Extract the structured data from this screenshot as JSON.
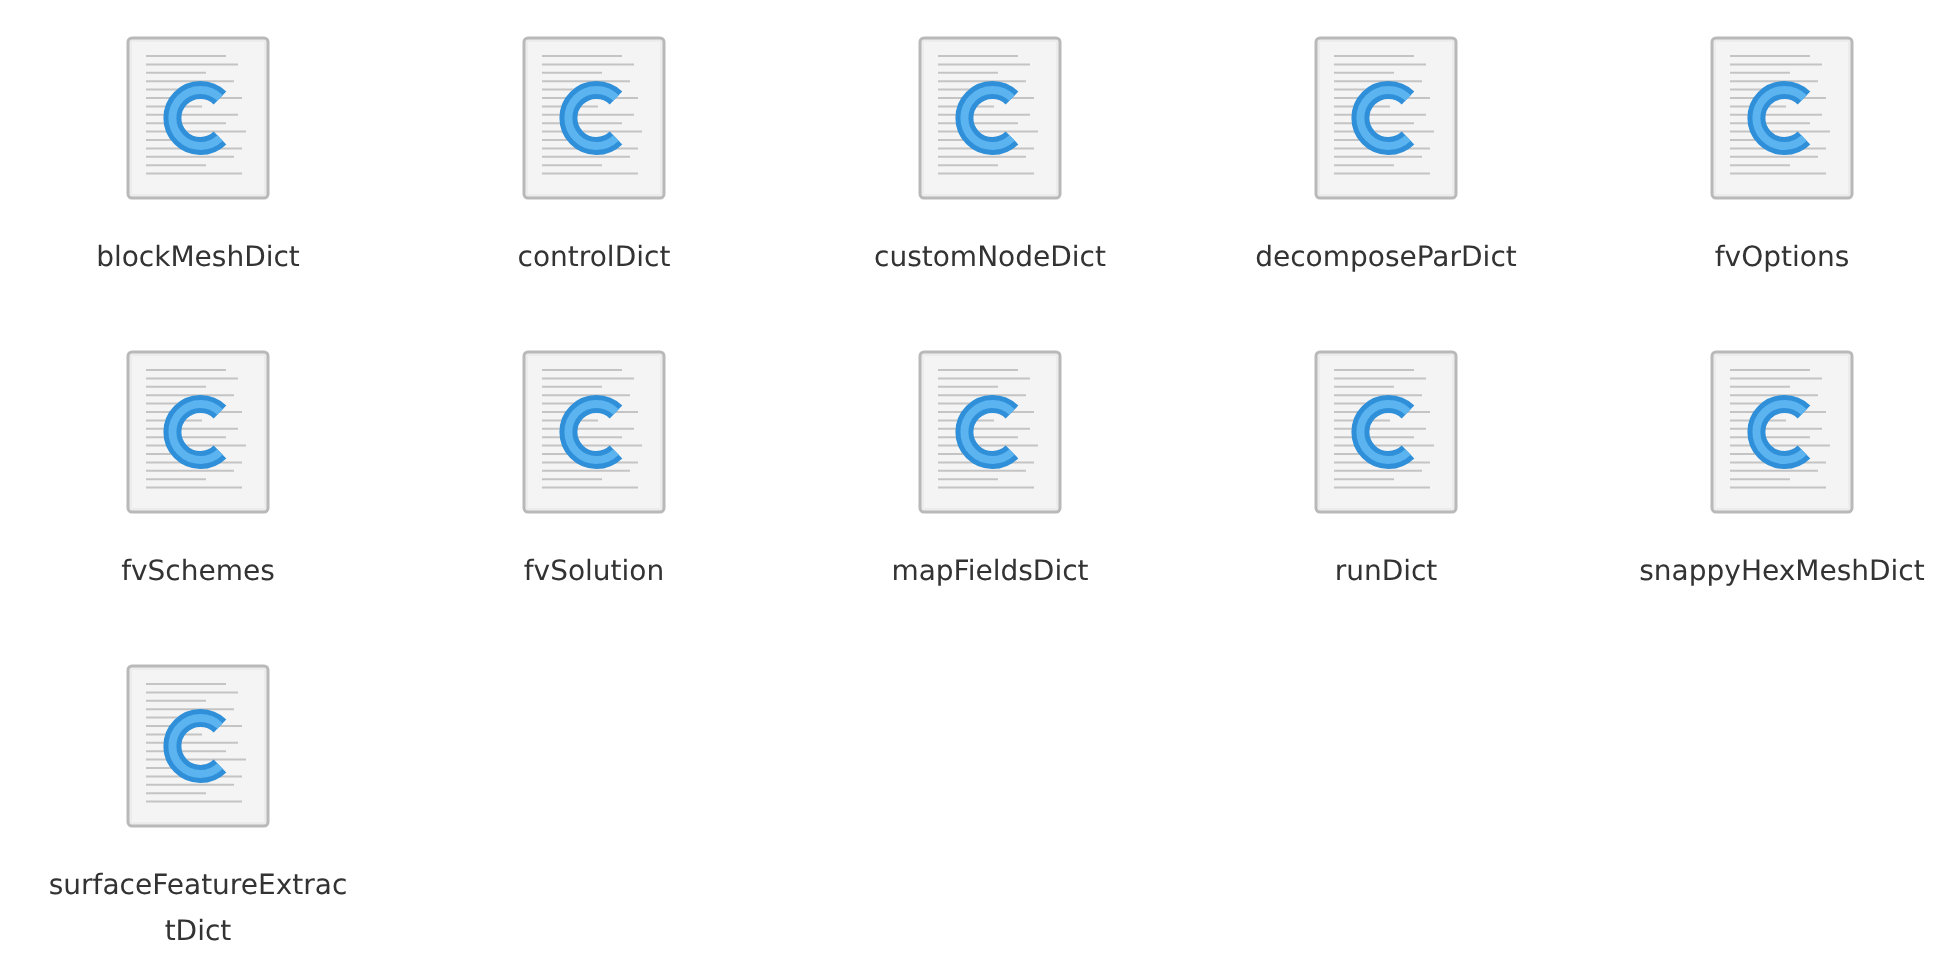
{
  "files": [
    {
      "name": "blockMeshDict"
    },
    {
      "name": "controlDict"
    },
    {
      "name": "customNodeDict"
    },
    {
      "name": "decomposeParDict"
    },
    {
      "name": "fvOptions"
    },
    {
      "name": "fvSchemes"
    },
    {
      "name": "fvSolution"
    },
    {
      "name": "mapFieldsDict"
    },
    {
      "name": "runDict"
    },
    {
      "name": "snappyHexMeshDict"
    },
    {
      "name": "surfaceFeatureExtractDict"
    }
  ]
}
